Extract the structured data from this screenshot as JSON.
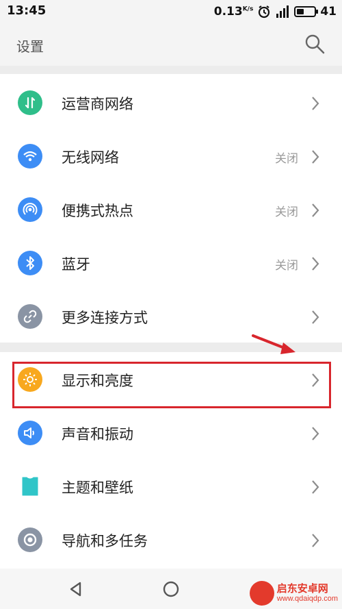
{
  "status_bar": {
    "time": "13:45",
    "speed": "0.13",
    "speed_unit": "K/s",
    "battery": "41"
  },
  "header": {
    "title": "设置",
    "search_icon": "search-icon"
  },
  "section1": [
    {
      "label": "运营商网络",
      "value": "",
      "icon": "updown-arrows-icon",
      "color": "#2fbe8a"
    },
    {
      "label": "无线网络",
      "value": "关闭",
      "icon": "wifi-icon",
      "color": "#3d8df5"
    },
    {
      "label": "便携式热点",
      "value": "关闭",
      "icon": "hotspot-icon",
      "color": "#3d8df5"
    },
    {
      "label": "蓝牙",
      "value": "关闭",
      "icon": "bluetooth-icon",
      "color": "#3d8df5"
    },
    {
      "label": "更多连接方式",
      "value": "",
      "icon": "link-icon",
      "color": "#8a94a4"
    }
  ],
  "section2": [
    {
      "label": "显示和亮度",
      "value": "",
      "icon": "sun-icon",
      "color": "#f8a81e"
    },
    {
      "label": "声音和振动",
      "value": "",
      "icon": "speaker-icon",
      "color": "#3d8df5"
    },
    {
      "label": "主题和壁纸",
      "value": "",
      "icon": "shirt-icon",
      "color": "#30c5c8"
    },
    {
      "label": "导航和多任务",
      "value": "",
      "icon": "navigation-ring-icon",
      "color": "#8a94a4"
    }
  ],
  "nav_bar": {
    "back_icon": "back-triangle-icon",
    "home_icon": "home-circle-icon"
  },
  "watermark": {
    "title": "启东安卓网",
    "url": "www.qdaiqdp.com"
  },
  "colors": {
    "highlight": "#d8262d",
    "background": "#ececec"
  }
}
